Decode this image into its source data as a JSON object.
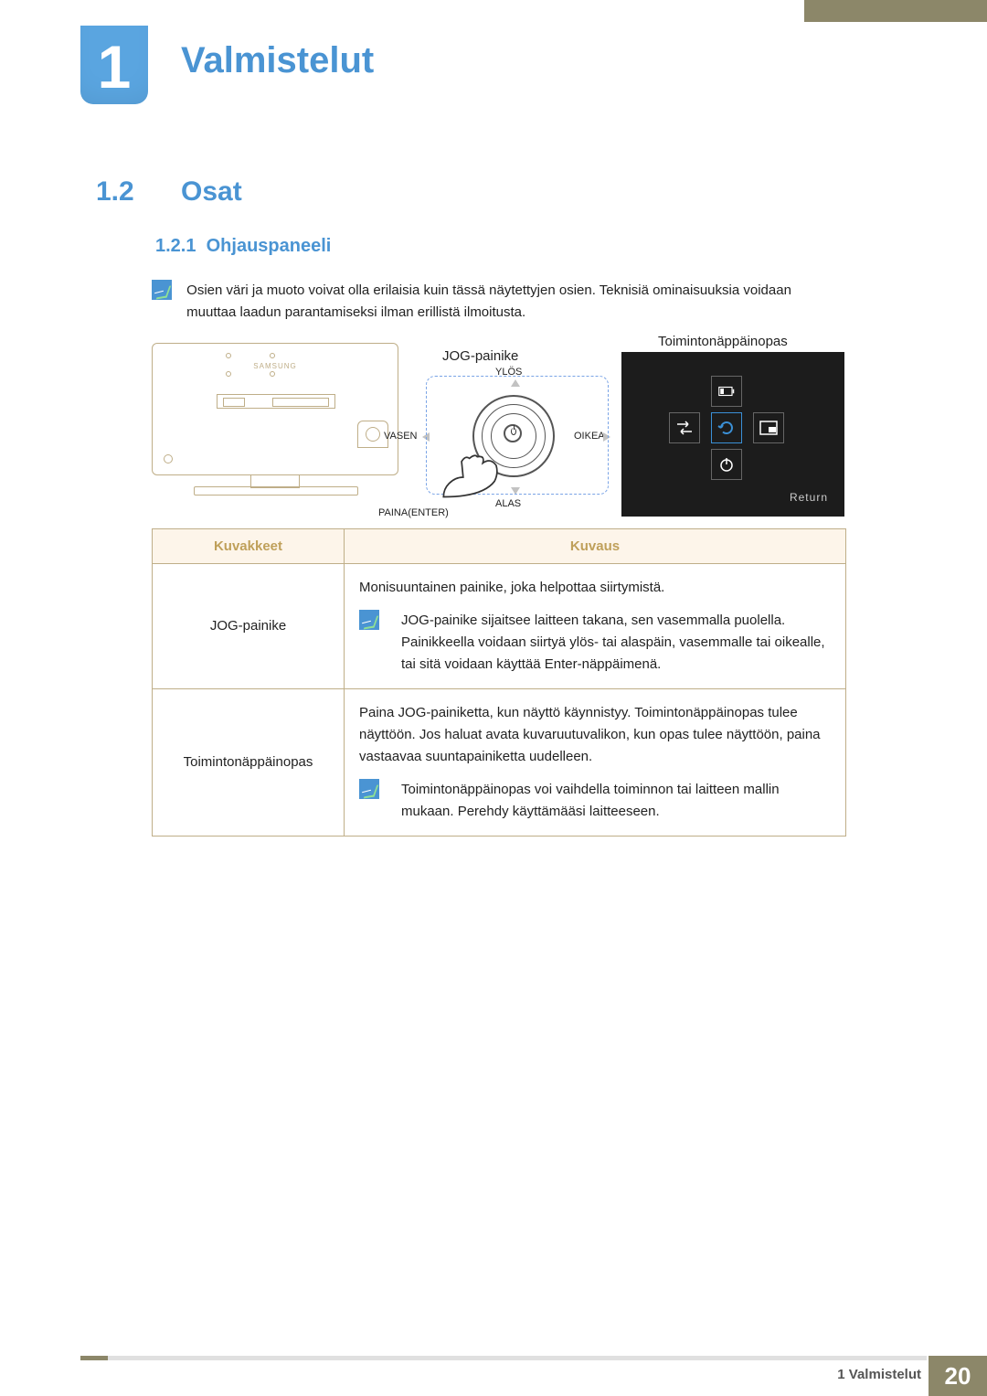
{
  "chapter": {
    "number": "1",
    "title": "Valmistelut"
  },
  "section": {
    "number": "1.2",
    "title": "Osat"
  },
  "subsection": {
    "number": "1.2.1",
    "title": "Ohjauspaneeli"
  },
  "note": "Osien väri ja muoto voivat olla erilaisia kuin tässä näytettyjen osien. Teknisiä ominaisuuksia voidaan muuttaa laadun parantamiseksi ilman erillistä ilmoitusta.",
  "diagram": {
    "brand": "SAMSUNG",
    "jog_title": "JOG-painike",
    "up": "YLÖS",
    "down": "ALAS",
    "left": "VASEN",
    "right": "OIKEA",
    "enter": "PAINA(ENTER)",
    "func_title": "Toimintonäppäinopas",
    "return": "Return"
  },
  "table": {
    "headers": [
      "Kuvakkeet",
      "Kuvaus"
    ],
    "rows": [
      {
        "name": "JOG-painike",
        "desc": "Monisuuntainen painike, joka helpottaa siirtymistä.",
        "note": "JOG-painike sijaitsee laitteen takana, sen vasemmalla puolella. Painikkeella voidaan siirtyä ylös- tai alaspäin, vasemmalle tai oikealle, tai sitä voidaan käyttää Enter-näppäimenä."
      },
      {
        "name": "Toimintonäppäinopas",
        "desc": "Paina JOG-painiketta, kun näyttö käynnistyy. Toimintonäppäinopas tulee näyttöön. Jos haluat avata kuvaruutuvalikon, kun opas tulee näyttöön, paina vastaavaa suuntapainiketta uudelleen.",
        "note": "Toimintonäppäinopas voi vaihdella toiminnon tai laitteen mallin mukaan. Perehdy käyttämääsi laitteeseen."
      }
    ]
  },
  "footer": {
    "label": "1 Valmistelut",
    "page": "20"
  }
}
